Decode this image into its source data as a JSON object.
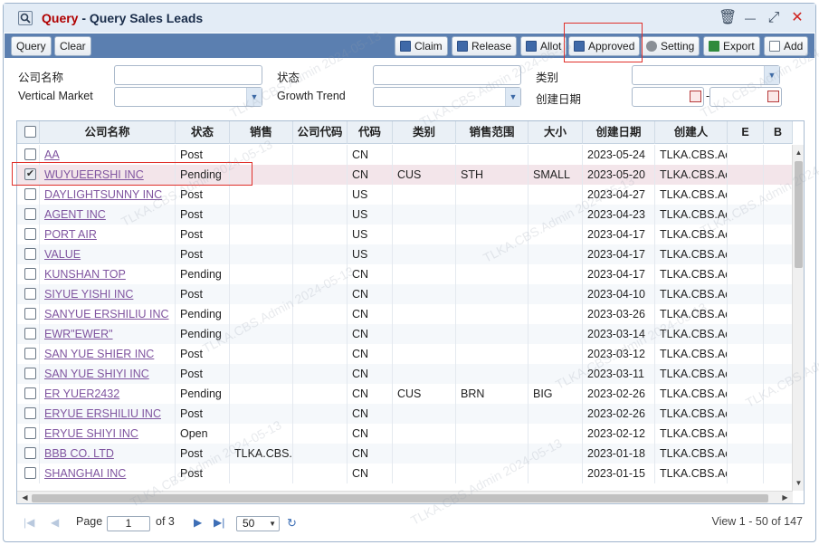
{
  "window": {
    "title_prefix": "Query",
    "title_sep": " - ",
    "title_main": "Query Sales Leads"
  },
  "window_controls": {
    "delete": "🗑",
    "minimize": "—",
    "maximize": "⤢",
    "close": "✕"
  },
  "toolbar": {
    "query": "Query",
    "clear": "Clear",
    "claim": "Claim",
    "release": "Release",
    "allot": "Allot",
    "approved": "Approved",
    "setting": "Setting",
    "export": "Export",
    "add": "Add"
  },
  "filters": {
    "company_name_label": "公司名称",
    "status_label": "状态",
    "category_label": "类别",
    "vertical_market_label": "Vertical Market",
    "growth_trend_label": "Growth Trend",
    "created_date_label": "创建日期",
    "date_sep": "-"
  },
  "columns": [
    "公司名称",
    "状态",
    "销售",
    "公司代码",
    "代码",
    "类别",
    "销售范围",
    "大小",
    "创建日期",
    "创建人",
    "E",
    "B"
  ],
  "rows": [
    {
      "checked": false,
      "company": "AA",
      "status": "Post",
      "sales": "",
      "code": "",
      "country": "CN",
      "category": "",
      "range": "",
      "size": "",
      "date": "2023-05-24",
      "creator": "TLKA.CBS.Ac"
    },
    {
      "checked": true,
      "company": "WUYUEERSHI INC",
      "status": "Pending",
      "sales": "",
      "code": "",
      "country": "CN",
      "category": "CUS",
      "range": "STH",
      "size": "SMALL",
      "date": "2023-05-20",
      "creator": "TLKA.CBS.Ac"
    },
    {
      "checked": false,
      "company": "DAYLIGHTSUNNY INC",
      "status": "Post",
      "sales": "",
      "code": "",
      "country": "US",
      "category": "",
      "range": "",
      "size": "",
      "date": "2023-04-27",
      "creator": "TLKA.CBS.Ac"
    },
    {
      "checked": false,
      "company": "AGENT INC",
      "status": "Post",
      "sales": "",
      "code": "",
      "country": "US",
      "category": "",
      "range": "",
      "size": "",
      "date": "2023-04-23",
      "creator": "TLKA.CBS.Ac"
    },
    {
      "checked": false,
      "company": "PORT AIR",
      "status": "Post",
      "sales": "",
      "code": "",
      "country": "US",
      "category": "",
      "range": "",
      "size": "",
      "date": "2023-04-17",
      "creator": "TLKA.CBS.Ac"
    },
    {
      "checked": false,
      "company": "VALUE",
      "status": "Post",
      "sales": "",
      "code": "",
      "country": "US",
      "category": "",
      "range": "",
      "size": "",
      "date": "2023-04-17",
      "creator": "TLKA.CBS.Ac"
    },
    {
      "checked": false,
      "company": "KUNSHAN TOP",
      "status": "Pending",
      "sales": "",
      "code": "",
      "country": "CN",
      "category": "",
      "range": "",
      "size": "",
      "date": "2023-04-17",
      "creator": "TLKA.CBS.Ac"
    },
    {
      "checked": false,
      "company": "SIYUE YISHI INC",
      "status": "Post",
      "sales": "",
      "code": "",
      "country": "CN",
      "category": "",
      "range": "",
      "size": "",
      "date": "2023-04-10",
      "creator": "TLKA.CBS.Ac"
    },
    {
      "checked": false,
      "company": "SANYUE ERSHILIU INC",
      "status": "Pending",
      "sales": "",
      "code": "",
      "country": "CN",
      "category": "",
      "range": "",
      "size": "",
      "date": "2023-03-26",
      "creator": "TLKA.CBS.Ac"
    },
    {
      "checked": false,
      "company": "EWR\"EWER\"",
      "status": "Pending",
      "sales": "",
      "code": "",
      "country": "CN",
      "category": "",
      "range": "",
      "size": "",
      "date": "2023-03-14",
      "creator": "TLKA.CBS.Ac"
    },
    {
      "checked": false,
      "company": "SAN YUE SHIER INC",
      "status": "Post",
      "sales": "",
      "code": "",
      "country": "CN",
      "category": "",
      "range": "",
      "size": "",
      "date": "2023-03-12",
      "creator": "TLKA.CBS.Ac"
    },
    {
      "checked": false,
      "company": "SAN YUE SHIYI INC",
      "status": "Post",
      "sales": "",
      "code": "",
      "country": "CN",
      "category": "",
      "range": "",
      "size": "",
      "date": "2023-03-11",
      "creator": "TLKA.CBS.Ac"
    },
    {
      "checked": false,
      "company": "ER YUER2432",
      "status": "Pending",
      "sales": "",
      "code": "",
      "country": "CN",
      "category": "CUS",
      "range": "BRN",
      "size": "BIG",
      "date": "2023-02-26",
      "creator": "TLKA.CBS.Ac"
    },
    {
      "checked": false,
      "company": "ERYUE ERSHILIU INC",
      "status": "Post",
      "sales": "",
      "code": "",
      "country": "CN",
      "category": "",
      "range": "",
      "size": "",
      "date": "2023-02-26",
      "creator": "TLKA.CBS.Ac"
    },
    {
      "checked": false,
      "company": "ERYUE SHIYI INC",
      "status": "Open",
      "sales": "",
      "code": "",
      "country": "CN",
      "category": "",
      "range": "",
      "size": "",
      "date": "2023-02-12",
      "creator": "TLKA.CBS.Ac"
    },
    {
      "checked": false,
      "company": "BBB CO. LTD",
      "status": "Post",
      "sales": "TLKA.CBS.A",
      "code": "",
      "country": "CN",
      "category": "",
      "range": "",
      "size": "",
      "date": "2023-01-18",
      "creator": "TLKA.CBS.Ac"
    },
    {
      "checked": false,
      "company": "SHANGHAI INC",
      "status": "Post",
      "sales": "",
      "code": "",
      "country": "CN",
      "category": "",
      "range": "",
      "size": "",
      "date": "2023-01-15",
      "creator": "TLKA.CBS.Ac"
    }
  ],
  "pager": {
    "page_label": "Page",
    "page_value": "1",
    "of_label": "of 3",
    "page_size": "50",
    "summary": "View 1 - 50 of 147"
  },
  "watermark": "TLKA.CBS.Admin 2024-05-13",
  "colors": {
    "toolbar_bg": "#5b7fb0",
    "link": "#8055a0",
    "highlight": "#e0302b",
    "selected_row": "#f3e5ea"
  }
}
